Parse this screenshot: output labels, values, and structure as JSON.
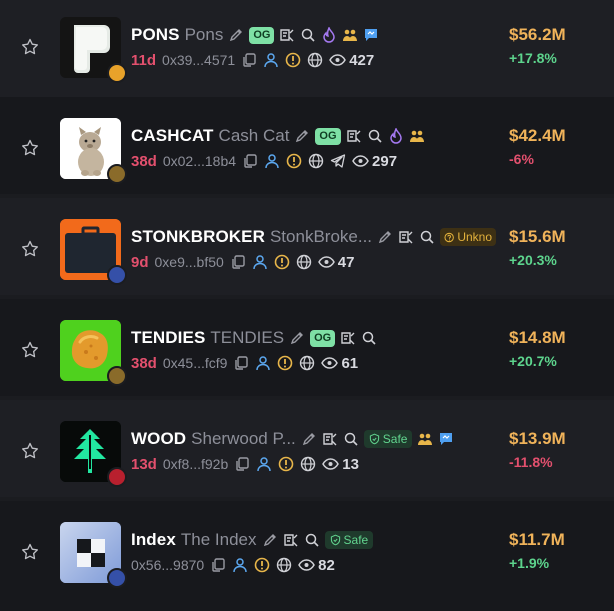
{
  "colors": {
    "market_cap": "#f0b35a",
    "positive": "#5dd48d",
    "negative": "#e3506e",
    "age": "#e3506e",
    "og_badge": "#7ee0a5",
    "safe_badge": "#62d58f",
    "unknown_badge": "#e2b13c"
  },
  "tokens": [
    {
      "symbol": "PONS",
      "name": "Pons",
      "age": "11d",
      "address": "0x39...4571",
      "views": "427",
      "market_cap": "$56.2M",
      "change": "+17.8%",
      "badges": [
        "OG"
      ],
      "icons": [
        "edit-icon",
        "og-badge",
        "chart-search-icon",
        "magnifier-icon",
        "flame-icon",
        "holders-icon",
        "chat-icon"
      ]
    },
    {
      "symbol": "CASHCAT",
      "name": "Cash Cat",
      "age": "38d",
      "address": "0x02...18b4",
      "views": "297",
      "market_cap": "$42.4M",
      "change": "-6%",
      "badges": [
        "OG"
      ],
      "icons": [
        "edit-icon",
        "og-badge",
        "chart-search-icon",
        "magnifier-icon",
        "flame-icon",
        "holders-icon"
      ]
    },
    {
      "symbol": "STONKBROKER",
      "name": "StonkBroke...",
      "age": "9d",
      "address": "0xe9...bf50",
      "views": "47",
      "market_cap": "$15.6M",
      "change": "+20.3%",
      "badges": [
        "Unkno"
      ],
      "icons": [
        "edit-icon",
        "chart-search-icon",
        "magnifier-icon"
      ]
    },
    {
      "symbol": "TENDIES",
      "name": "TENDIES",
      "age": "38d",
      "address": "0x45...fcf9",
      "views": "61",
      "market_cap": "$14.8M",
      "change": "+20.7%",
      "badges": [
        "OG"
      ],
      "icons": [
        "edit-icon",
        "og-badge",
        "chart-search-icon",
        "magnifier-icon"
      ]
    },
    {
      "symbol": "WOOD",
      "name": "Sherwood P...",
      "age": "13d",
      "address": "0xf8...f92b",
      "views": "13",
      "market_cap": "$13.9M",
      "change": "-11.8%",
      "badges": [
        "Safe"
      ],
      "icons": [
        "edit-icon",
        "chart-search-icon",
        "magnifier-icon",
        "holders-icon",
        "chat-icon"
      ]
    },
    {
      "symbol": "Index",
      "name": "The Index",
      "age": "",
      "address": "0x56...9870",
      "views": "82",
      "market_cap": "$11.7M",
      "change": "+1.9%",
      "badges": [
        "Safe"
      ],
      "icons": [
        "edit-icon",
        "chart-search-icon",
        "magnifier-icon"
      ]
    }
  ]
}
